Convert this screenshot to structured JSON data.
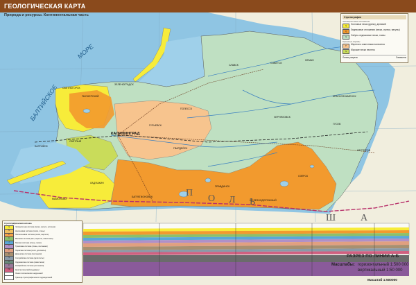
{
  "header": {
    "title": "ГЕОЛОГИЧЕСКАЯ КАРТА",
    "subtitle": "Природа и ресурсы. Континентальная часть"
  },
  "colors": {
    "sea": "#8fc5e3",
    "lagoon": "#9fd0ea",
    "quaternary_green": "#bfe0c2",
    "orange": "#f29a2e",
    "light_orange": "#f7c48e",
    "yellow": "#f7ec3a",
    "yellow_green": "#c9dc5a",
    "title_bg": "#8a4a1c"
  },
  "map": {
    "sea_labels": [
      "БАЛТИЙСКОЕ",
      "МОРЕ"
    ],
    "cities": [
      {
        "name": "КАЛИНИНГРАД"
      },
      {
        "name": "СОВЕТСК"
      },
      {
        "name": "ЧЕРНЯХОВСК"
      },
      {
        "name": "ГУСЕВ"
      },
      {
        "name": "НЕМАН"
      },
      {
        "name": "СЛАВСК"
      },
      {
        "name": "ГВАРДЕЙСК"
      },
      {
        "name": "ПОЛЕССК"
      },
      {
        "name": "ЗЕЛЕНОГРАДСК"
      },
      {
        "name": "СВЕТЛОГОРСК"
      },
      {
        "name": "БАЛТИЙСК"
      },
      {
        "name": "СВЕТЛЫЙ"
      },
      {
        "name": "МАМОНОВО"
      },
      {
        "name": "БАГРАТИОНОВСК"
      },
      {
        "name": "ПРАВДИНСК"
      },
      {
        "name": "ОЗЁРСК"
      },
      {
        "name": "НЕСТЕРОВ"
      },
      {
        "name": "КРАСНОЗНАМЕНСК"
      },
      {
        "name": "ЖЕЛЕЗНОДОРОЖНЫЙ"
      },
      {
        "name": "ЛАДУШКИН"
      },
      {
        "name": "ПИОНЕРСКИЙ"
      },
      {
        "name": "ГУРЬЕВСК"
      }
    ],
    "country_letters": [
      "П",
      "О",
      "Л",
      "Ь",
      "Ш",
      "А"
    ],
    "line_label": "А",
    "line_label_end": "Б"
  },
  "legend": {
    "heading": "Стратиграфия",
    "sec1": "Четвертичные отложения",
    "sec2": "Коренные породы",
    "items": [
      {
        "code": "Q",
        "color": "#f7ec3a",
        "text": "Эолловые пески (дюны), делювий"
      },
      {
        "code": "Q",
        "color": "#f29a2e",
        "text": "Ледниковые отложения (пески, супеси, валуны)"
      },
      {
        "code": "Q",
        "color": "#bfe0c2",
        "text": "Озёрно-ледниковые пески, глины"
      },
      {
        "code": "P",
        "color": "#f7c48e",
        "text": "Мергели и известняки палеогена"
      },
      {
        "code": "N",
        "color": "#c9dc5a",
        "text": "Морские пески неогена"
      }
    ],
    "symbols": [
      "Линия разреза",
      "Скважины"
    ]
  },
  "stratigraphy": {
    "heading": "Стратиграфическая колонка",
    "rows": [
      {
        "code": "Q",
        "color": "#f7ec3a",
        "text": "Четвертичная система (пески, супеси, суглинки)"
      },
      {
        "code": "N",
        "color": "#f0c060",
        "text": "Неогеновая система (пески, глины)"
      },
      {
        "code": "P",
        "color": "#f5a44a",
        "text": "Палеогеновая система (пески, мергели)"
      },
      {
        "code": "K",
        "color": "#8cc06a",
        "text": "Меловая система (мел, мергели, известняки)"
      },
      {
        "code": "J",
        "color": "#5aa8d8",
        "text": "Юрская система (глины, пески)"
      },
      {
        "code": "T",
        "color": "#b090c8",
        "text": "Триасовая система (глины, песчаники)"
      },
      {
        "code": "P",
        "color": "#e0a080",
        "text": "Пермская система (соли, доломиты)"
      },
      {
        "code": "D",
        "color": "#a89070",
        "text": "Девонская система (песчаники)"
      },
      {
        "code": "S",
        "color": "#8a9aa8",
        "text": "Силурийская система (аргиллиты)"
      },
      {
        "code": "O",
        "color": "#6a8a7a",
        "text": "Ордовикская система (известняки)"
      },
      {
        "code": "Є",
        "color": "#9a7a9a",
        "text": "Кембрийская система (песчаники)"
      },
      {
        "code": "PR",
        "color": "#d06080",
        "text": "Кристаллический фундамент"
      },
      {
        "code": "",
        "color": "#ffffff",
        "text": "Линия тектонических нарушений"
      },
      {
        "code": "",
        "color": "#ffffff",
        "text": "Граница стратиграфических подразделений"
      }
    ]
  },
  "section": {
    "title": "РАЗРЕЗ ПО ЛИНИИ А-Б",
    "scale_label": "Масштабы:",
    "horizontal": "горизонтальный 1:500 000",
    "vertical": "вертикальный 1:50 000"
  },
  "scale": "Масштаб 1:500000"
}
